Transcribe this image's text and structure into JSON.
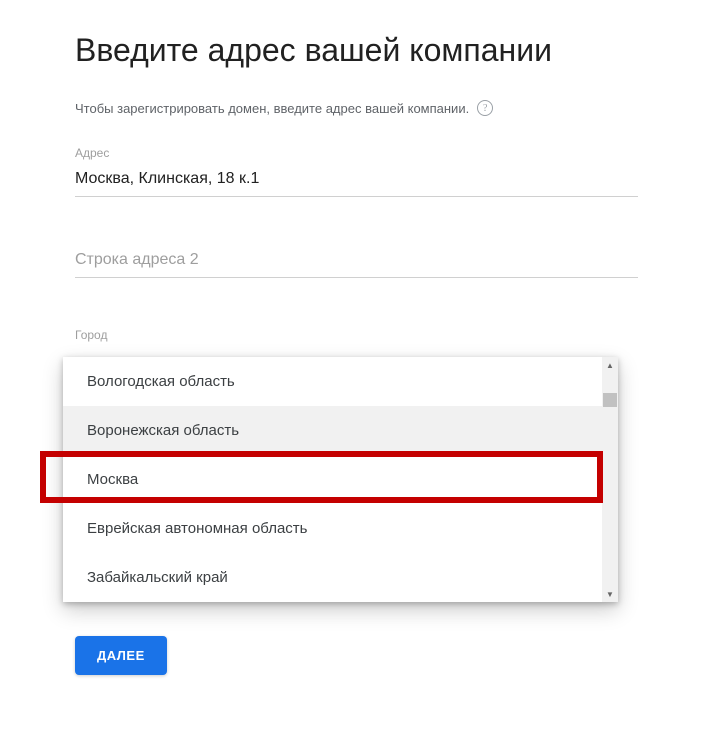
{
  "heading": "Введите адрес вашей компании",
  "instruction": "Чтобы зарегистрировать домен, введите адрес вашей компании.",
  "fields": {
    "address": {
      "label": "Адрес",
      "value": "Москва, Клинская, 18 к.1"
    },
    "address2": {
      "placeholder": "Строка адреса 2",
      "value": ""
    },
    "city_label_partial": "Город"
  },
  "dropdown": {
    "items": [
      "Вологодская область",
      "Воронежская область",
      "Москва",
      "Еврейская автономная область",
      "Забайкальский край"
    ],
    "hovered_index": 1,
    "highlighted_index": 2
  },
  "button": {
    "next": "ДАЛЕЕ"
  }
}
